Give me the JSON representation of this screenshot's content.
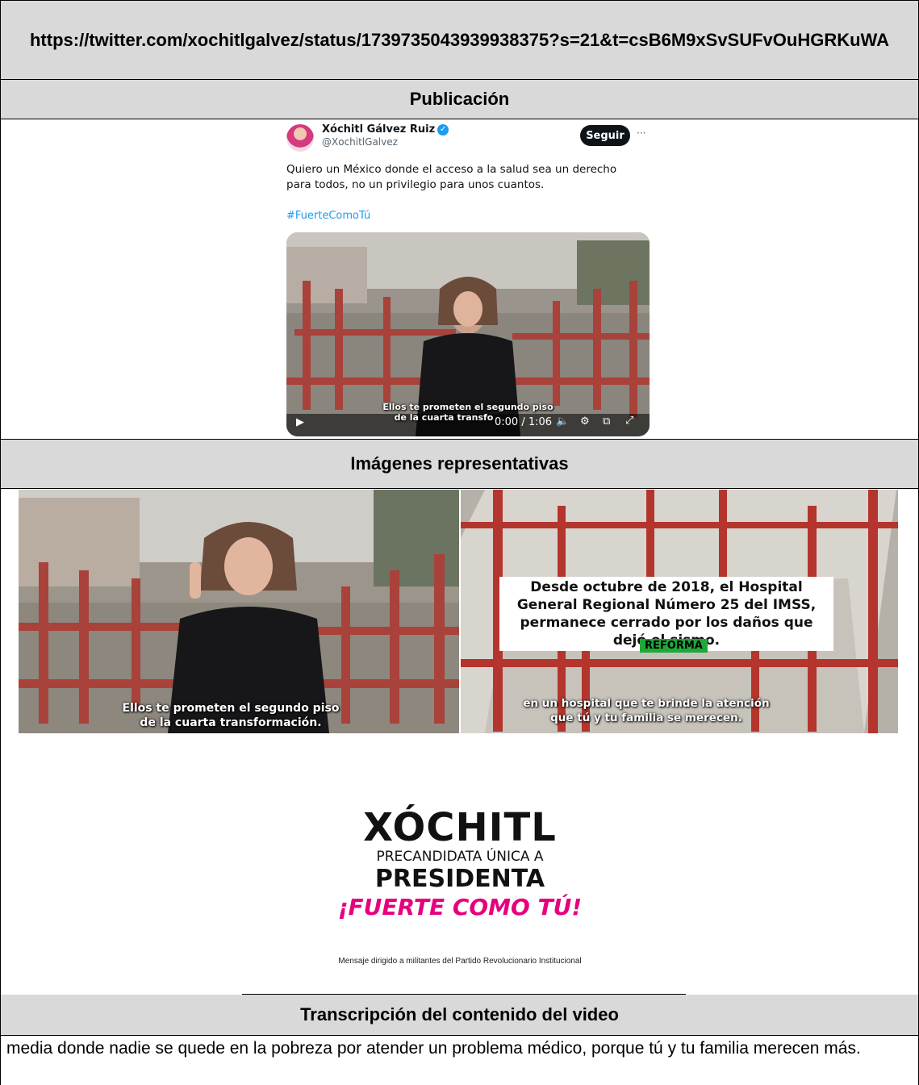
{
  "url_header": "https://twitter.com/xochitlgalvez/status/1739735043939938375?s=21&t=csB6M9xSvSUFvOuHGRKuWA",
  "sections": {
    "publication": "Publicación",
    "images": "Imágenes representativas",
    "transcription": "Transcripción del contenido del video"
  },
  "tweet": {
    "author_name": "Xóchitl Gálvez Ruiz",
    "handle": "@XochitlGalvez",
    "follow_label": "Seguir",
    "more_label": "···",
    "text": "Quiero un México donde el acceso a la salud sea un derecho para todos, no un privilegio para unos cuantos.",
    "hashtag": "#FuerteComoTú",
    "video_caption_line1": "Ellos te prometen el segundo piso",
    "video_caption_line2": "de la cuarta transfo",
    "video_time": "0:00 / 1:06"
  },
  "images": {
    "left_caption_line1": "Ellos te prometen el segundo piso",
    "left_caption_line2": "de la cuarta transformación.",
    "right_headline": "Desde octubre de 2018, el Hospital General Regional Número 25 del IMSS, permanece cerrado por los daños que dejó el sismo.",
    "right_source": "REFORMA",
    "right_caption_line1": "en un hospital que te brinde la atención",
    "right_caption_line2": "que tú y tu familia se merecen."
  },
  "logo": {
    "name": "XÓCHITL",
    "line2": "PRECANDIDATA ÚNICA A",
    "line3": "PRESIDENTA",
    "slogan": "¡FUERTE COMO TÚ!",
    "disclaimer": "Mensaje dirigido a militantes del Partido Revolucionario Institucional"
  },
  "transcription_text": "media donde nadie se quede en la pobreza por atender un problema médico, porque tú y tu familia merecen más.",
  "colors": {
    "header_bg": "#d9d9d9",
    "link_blue": "#1d9bf0",
    "slogan_pink": "#e6007e",
    "steel_red": "#a8423a",
    "reforma_green": "#1fa83a"
  }
}
